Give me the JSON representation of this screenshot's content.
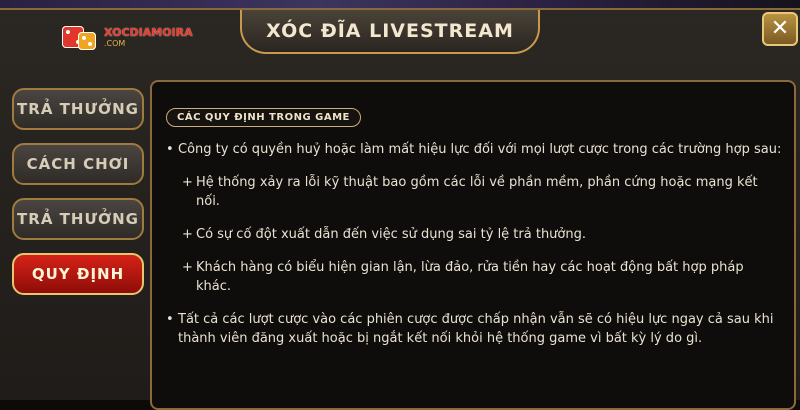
{
  "header": {
    "title": "XÓC ĐĨA LIVESTREAM",
    "logo_main": "XOCDIAMOIRA",
    "logo_sub": ".COM",
    "close_label": "✕"
  },
  "sidebar": {
    "items": [
      {
        "label": "TRẢ THƯỞNG",
        "active": false
      },
      {
        "label": "CÁCH CHƠI",
        "active": false
      },
      {
        "label": "TRẢ THƯỞNG",
        "active": false
      },
      {
        "label": "QUY ĐỊNH",
        "active": true
      }
    ]
  },
  "content": {
    "section_title": "CÁC QUY ĐỊNH TRONG GAME",
    "bullet_symbol": "•",
    "plus_symbol": "+",
    "para1": "Công ty có quyền huỷ hoặc làm mất hiệu lực đối với mọi lượt cược trong các trường hợp sau:",
    "sub1": "Hệ thống xảy ra lỗi kỹ thuật bao gồm các lỗi về phần mềm, phần cứng hoặc mạng kết nối.",
    "sub2": "Có sự cố đột xuất dẫn đến việc sử dụng sai tỷ lệ trả thưởng.",
    "sub3": "Khách hàng có biểu hiện gian lận, lừa đảo, rửa tiền hay các hoạt động bất hợp pháp khác.",
    "para2": "Tất cả các lượt cược vào các phiên cược được chấp nhận vẫn sẽ có hiệu lực ngay cả sau khi thành viên đăng xuất hoặc bị ngắt kết nối khỏi hệ thống game vì bất kỳ lý do gì."
  },
  "colors": {
    "accent_gold": "#c79a4d",
    "active_red": "#d62318",
    "panel_bg": "#0f0d0b"
  }
}
